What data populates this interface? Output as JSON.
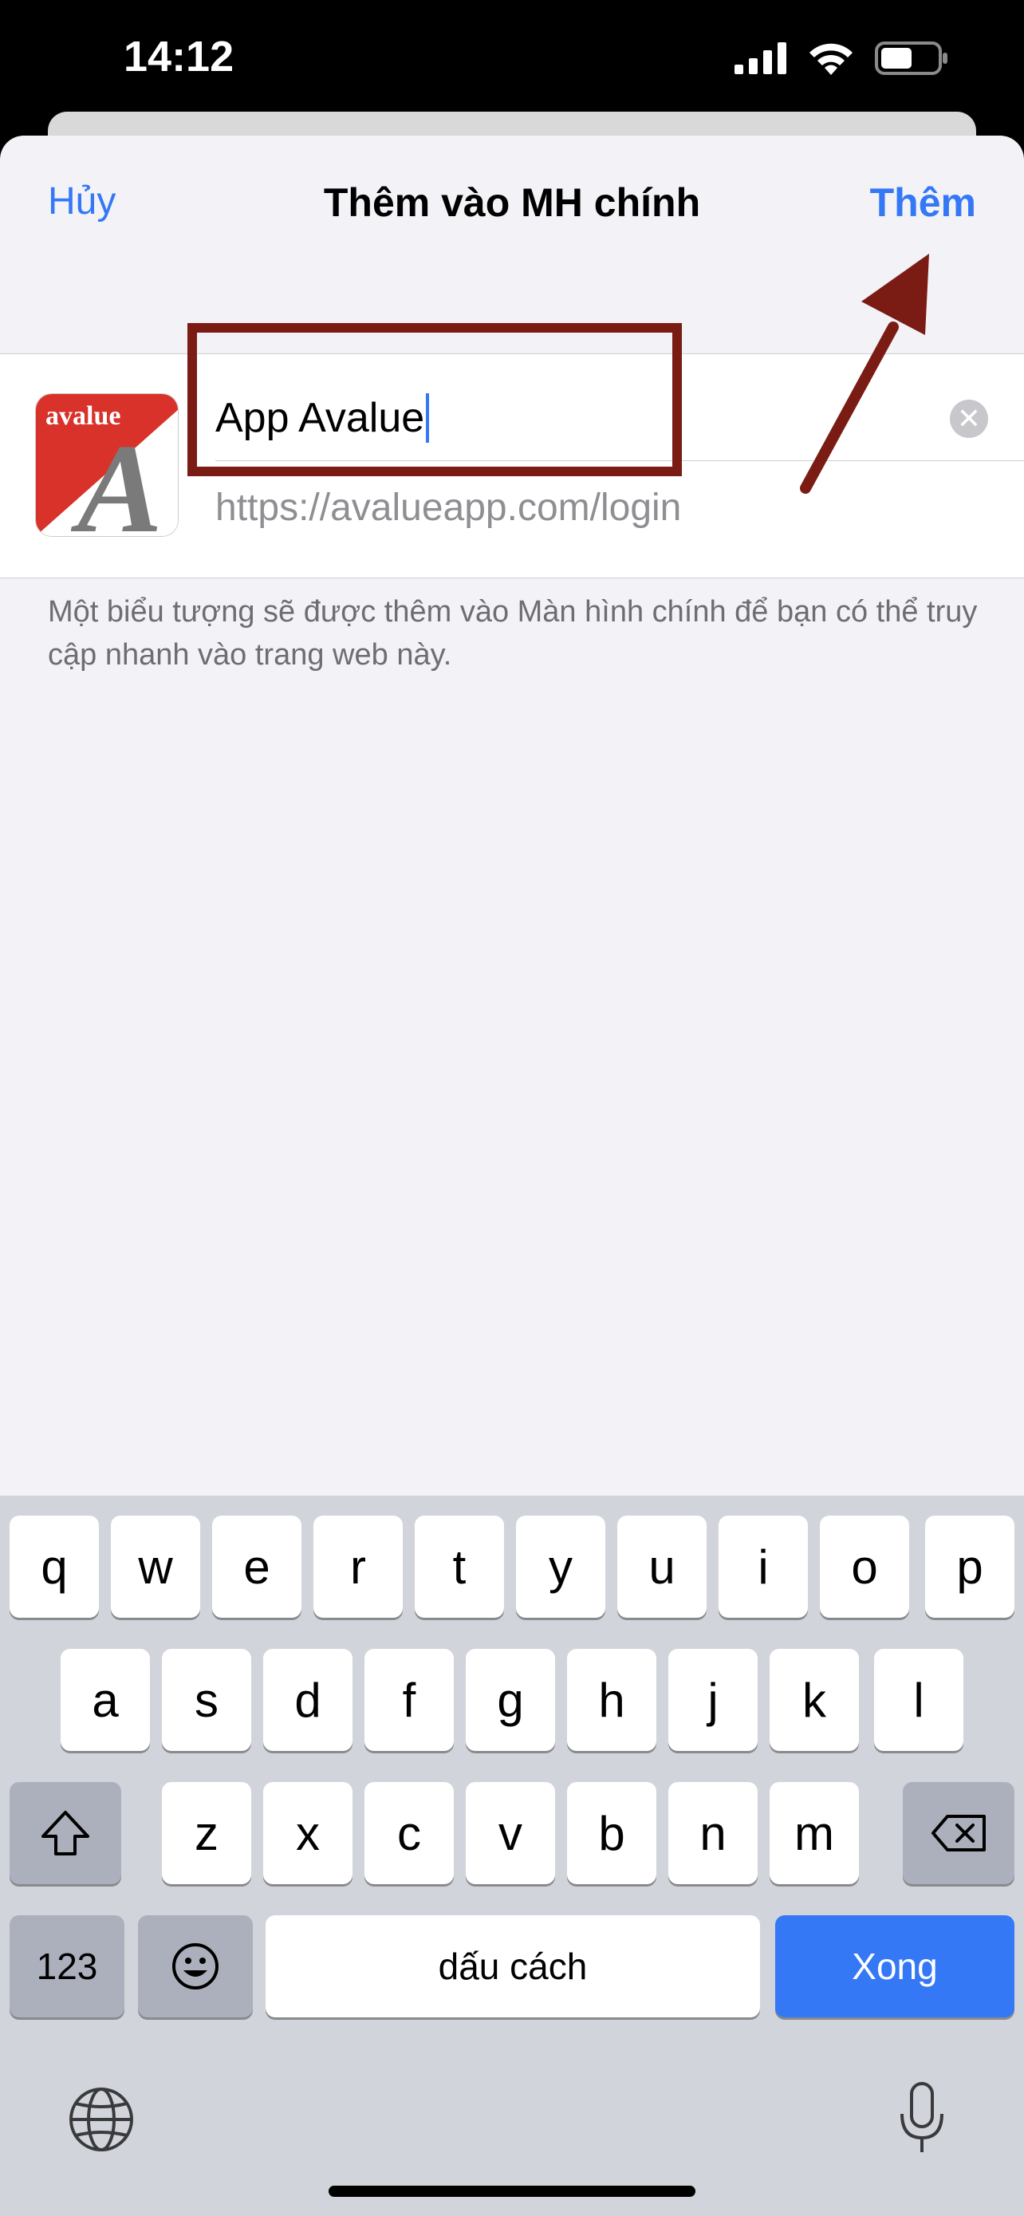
{
  "status_bar": {
    "time": "14:12"
  },
  "nav": {
    "cancel_label": "Hủy",
    "title": "Thêm vào MH chính",
    "add_label": "Thêm"
  },
  "app_icon": {
    "logo_text": "avalue",
    "letter": "A"
  },
  "form": {
    "name_value": "App Avalue",
    "url": "https://avalueapp.com/login",
    "footnote": "Một biểu tượng sẽ được thêm vào Màn hình chính để bạn có thể truy cập nhanh vào trang web này."
  },
  "keyboard": {
    "row1": [
      "q",
      "w",
      "e",
      "r",
      "t",
      "y",
      "u",
      "i",
      "o",
      "p"
    ],
    "row2": [
      "a",
      "s",
      "d",
      "f",
      "g",
      "h",
      "j",
      "k",
      "l"
    ],
    "row3": [
      "z",
      "x",
      "c",
      "v",
      "b",
      "n",
      "m"
    ],
    "numbers_label": "123",
    "space_label": "dấu cách",
    "done_label": "Xong"
  },
  "colors": {
    "accent": "#3478f6",
    "annotation": "#7a1c14"
  }
}
